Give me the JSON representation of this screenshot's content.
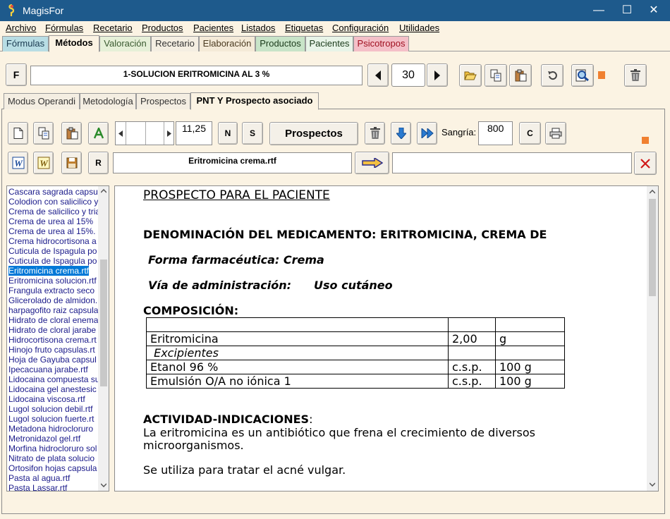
{
  "window": {
    "title": "MagisFor",
    "minimize": "—",
    "maximize": "☐",
    "close": "✕"
  },
  "menu": [
    "Archivo",
    "Fórmulas",
    "Recetario",
    "Productos",
    "Pacientes",
    "Listados",
    "Etiquetas",
    "Configuración",
    "Utilidades"
  ],
  "main_tabs": [
    "Fórmulas",
    "Métodos",
    "Valoración",
    "Recetario",
    "Elaboración",
    "Productos",
    "Pacientes",
    "Psicotropos"
  ],
  "active_main_tab": "Métodos",
  "toolbar1": {
    "f_button": "F",
    "formula_name": "1-SOLUCION ERITROMICINA AL 3 %",
    "record_number": "30"
  },
  "sub_tabs": [
    "Modus Operandi",
    "Metodología",
    "Prospectos",
    "PNT Y Prospecto asociado"
  ],
  "active_sub_tab": "PNT Y Prospecto asociado",
  "toolbar2": {
    "font_size": "11,25",
    "n_button": "N",
    "s_button": "S",
    "prospectos_button": "Prospectos",
    "sangria_label": "Sangría:",
    "sangria_value": "800",
    "c_button": "C"
  },
  "toolbar3": {
    "r_button": "R",
    "file_name": "Eritromicina crema.rtf",
    "target_field": ""
  },
  "file_list": [
    "Cascara sagrada capsulas",
    "Colodion con salicilico y",
    "Crema de salicilico y tria",
    "Crema de urea al 15%",
    "Crema de urea al 15%.",
    "Crema hidrocortisona a",
    "Cuticula de Ispagula po",
    "Cuticula de Ispagula po",
    "Eritromicina crema.rtf",
    "Eritromicina solucion.rtf",
    "Frangula extracto seco",
    "Glicerolado de almidon.",
    "harpagofito raiz capsula",
    "Hidrato de cloral enema",
    "Hidrato de cloral jarabe",
    "Hidrocortisona crema.rt",
    "Hinojo fruto capsulas.rt",
    "Hoja de Gayuba capsul",
    "Ipecacuana jarabe.rtf",
    "Lidocaina compuesta su",
    "Lidocaina gel anestesic",
    "Lidocaina viscosa.rtf",
    "Lugol solucion debil.rtf",
    "Lugol solucion fuerte.rt",
    "Metadona hidrocloruro",
    "Metronidazol gel.rtf",
    "Morfina hidrocloruro sol",
    "Nitrato de plata solucio",
    "Ortosifon hojas capsula",
    "Pasta al agua.rtf",
    "Pasta Lassar.rtf"
  ],
  "selected_file_index": 8,
  "document": {
    "heading": "PROSPECTO PARA EL PACIENTE",
    "denominacion": "DENOMINACIÓN DEL MEDICAMENTO: ERITROMICINA, CREMA DE",
    "forma": "Forma farmacéutica: Crema",
    "via_label": "Vía de administración:",
    "via_value": "Uso cutáneo",
    "composicion": "COMPOSICIÓN:",
    "table": [
      [
        "",
        "",
        ""
      ],
      [
        "Eritromicina",
        "2,00",
        "g"
      ],
      [
        " Excipientes",
        "",
        ""
      ],
      [
        "Etanol 96 %",
        "c.s.p.",
        "100 g"
      ],
      [
        "Emulsión O/A no iónica 1",
        "c.s.p.",
        "100 g"
      ]
    ],
    "actividad_heading": "ACTIVIDAD-INDICACIONES",
    "actividad_colon": ":",
    "actividad_line1": "La eritromicina es un antibiótico que frena el crecimiento de diversos",
    "actividad_line2": "microorganismos.",
    "uso": "Se utiliza para tratar el acné vulgar."
  },
  "colors": {
    "titlebar": "#1e5a8c",
    "background": "#fbf3e3",
    "selection": "#0078d7",
    "psicotropos_tab": "#f4c0c8",
    "close_red": "#d01818"
  }
}
